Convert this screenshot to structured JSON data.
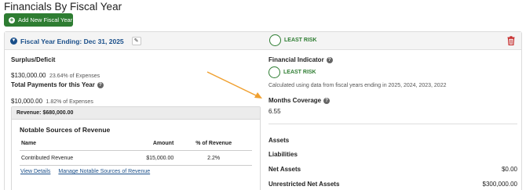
{
  "page": {
    "title": "Financials By Fiscal Year"
  },
  "toolbar": {
    "add_label": "Add New Fiscal Year"
  },
  "fiscal_year": {
    "title": "Fiscal Year Ending: Dec 31, 2025",
    "risk_label": "LEAST RISK"
  },
  "left": {
    "surplus_label": "Surplus/Deficit",
    "surplus_value": "$130,000.00",
    "surplus_note": "23.64% of Expenses",
    "total_label": "Total Payments for this Year",
    "total_value": "$10,000.00",
    "total_note": "1.82% of Expenses"
  },
  "revenue": {
    "header": "Revenue: $680,000.00",
    "title": "Notable Sources of Revenue",
    "columns": [
      "Name",
      "Amount",
      "% of Revenue"
    ],
    "rows": [
      {
        "name": "Contributed Revenue",
        "amount": "$15,000.00",
        "pct": "2.2%"
      }
    ],
    "link_details": "View Details",
    "link_manage": "Manage Notable Sources of Revenue"
  },
  "right": {
    "indicator_label": "Financial Indicator",
    "indicator_risk": "LEAST RISK",
    "calc_note": "Calculated using data from fiscal years ending in 2025, 2024, 2023, 2022",
    "months_label": "Months Coverage",
    "months_value": "6.55",
    "assets_label": "Assets",
    "liabilities_label": "Liabilities",
    "net_assets_label": "Net Assets",
    "net_assets_value": "$0.00",
    "unrestricted_label": "Unrestricted Net Assets",
    "unrestricted_value": "$300,000.00"
  },
  "colors": {
    "brand_green": "#2e7d32",
    "link_blue": "#1a4f8a",
    "delete_red": "#c62828",
    "annotation_orange": "#f0a030"
  },
  "icons": {
    "add": "plus-circle-icon",
    "collapse": "chevron-down-icon",
    "edit": "pencil-icon",
    "delete": "trash-icon",
    "help": "question-icon"
  }
}
